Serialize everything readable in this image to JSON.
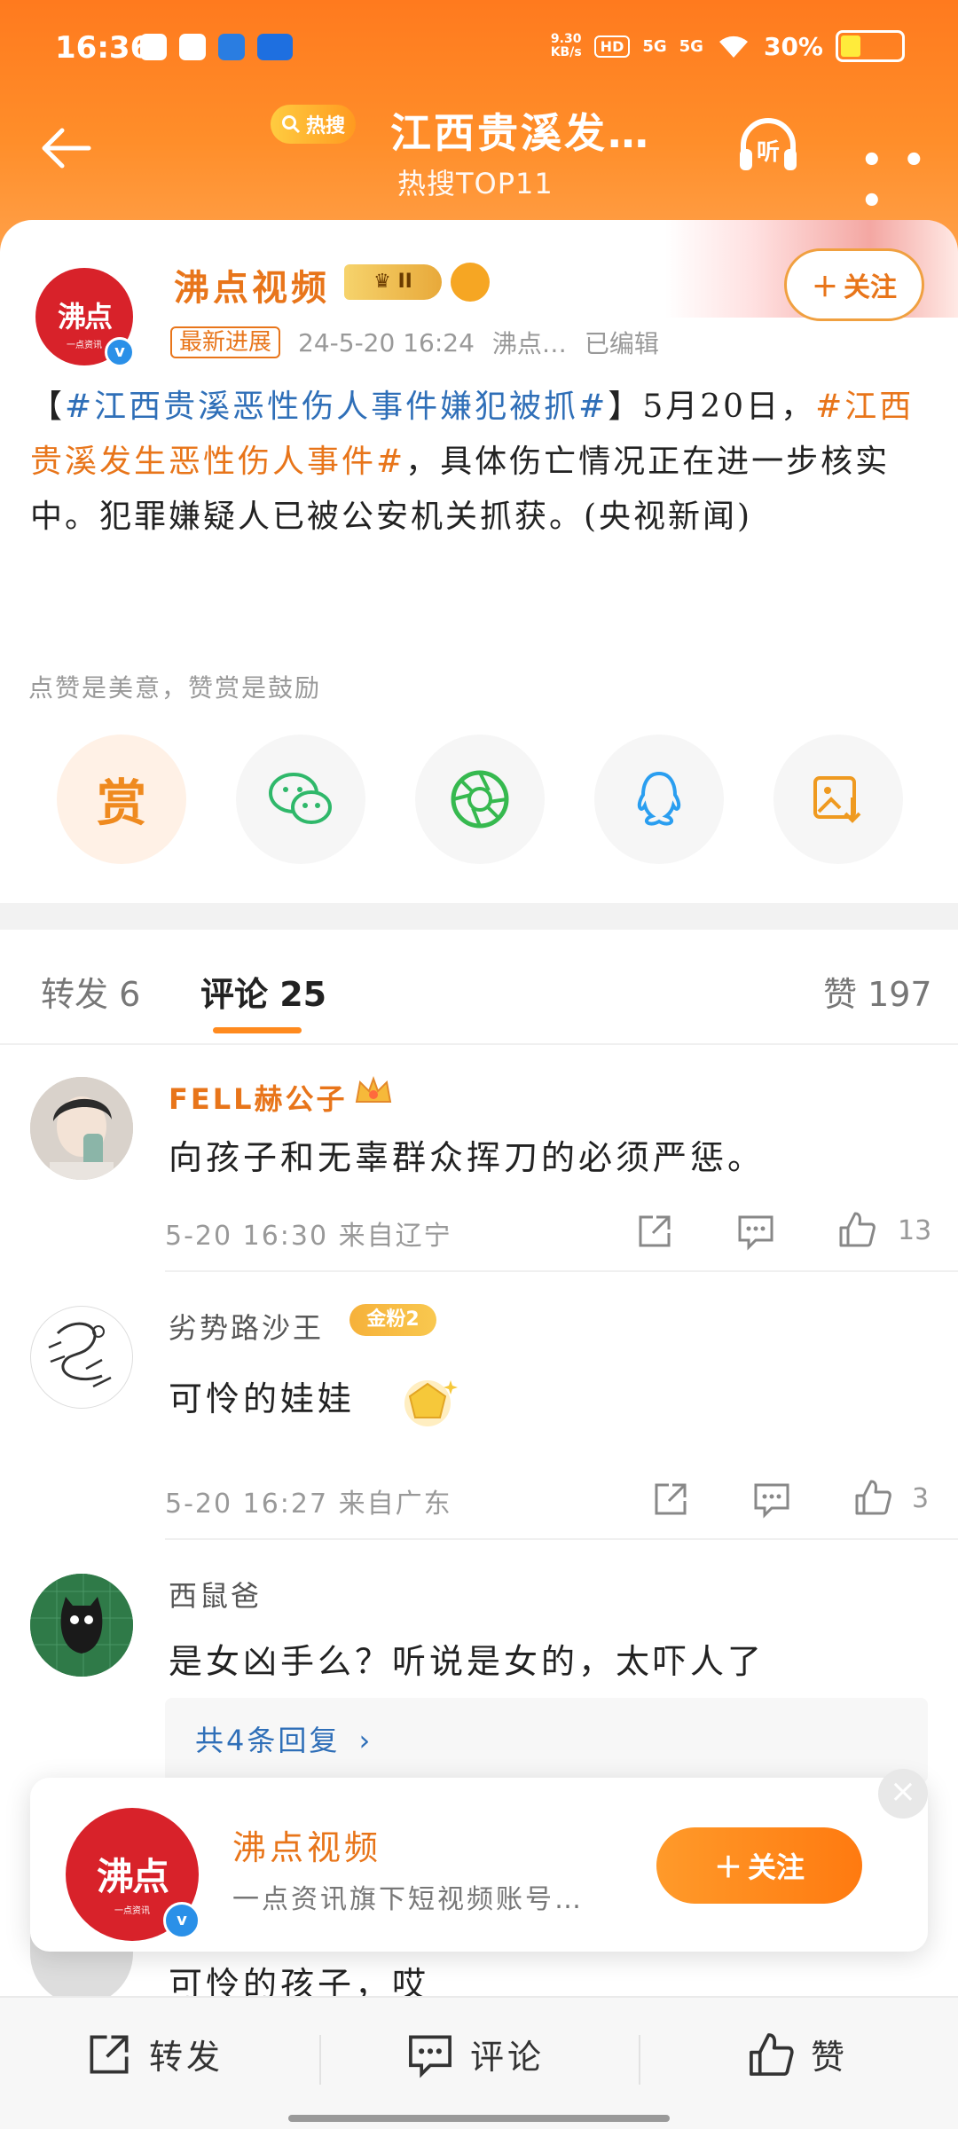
{
  "status_bar": {
    "time": "16:36",
    "net_speed_value": "9.30",
    "net_speed_unit": "KB/s",
    "hd": "HD",
    "sig1": "5G",
    "sig2": "5G",
    "battery": "30%"
  },
  "header": {
    "hot_label": "热搜",
    "title": "江西贵溪发…",
    "subtitle": "热搜TOP11",
    "listen_label": "听"
  },
  "post": {
    "account_name": "沸点视频",
    "avatar_text": "沸点",
    "avatar_sub": "一点资讯",
    "rank_badge": "II",
    "tag": "最新进展",
    "date": "24-5-20 16:24",
    "source": "沸点…",
    "edited": "已编辑",
    "follow_label": "关注",
    "text_lead": "【",
    "hashtag1": "#江西贵溪恶性伤人事件嫌犯被抓#",
    "text_mid": "】5月20日，",
    "hashtag2": "#江西贵溪发生恶性伤人事件#",
    "text_tail": "，具体伤亡情况正在进一步核实中。犯罪嫌疑人已被公安机关抓获。(央视新闻)",
    "reward_tip": "点赞是美意，赞赏是鼓励",
    "reward_char": "赏"
  },
  "tabs": {
    "repost": "转发 6",
    "comments": "评论 25",
    "likes": "赞 197"
  },
  "comments": [
    {
      "name": "FELL赫公子",
      "text": "向孩子和无辜群众挥刀的必须严惩。",
      "time": "5-20 16:30",
      "location": "来自辽宁",
      "likes": "13"
    },
    {
      "name": "劣势路沙王",
      "badge": "金粉2",
      "text": "可怜的娃娃",
      "time": "5-20 16:27",
      "location": "来自广东",
      "likes": "3"
    },
    {
      "name": "西鼠爸",
      "text": "是女凶手么？听说是女的，太吓人了",
      "replies": "共4条回复"
    }
  ],
  "float_card": {
    "name": "沸点视频",
    "desc": "一点资讯旗下短视频账号…",
    "follow_label": "关注",
    "close": "×"
  },
  "partial_comment": {
    "text": "可怜的孩子，哎"
  },
  "bottom_bar": {
    "repost": "转发",
    "comment": "评论",
    "like": "赞"
  },
  "colors": {
    "brand_orange": "#ff7a1e",
    "accent_orange": "#e8751a",
    "link_blue": "#2f6fb8"
  }
}
